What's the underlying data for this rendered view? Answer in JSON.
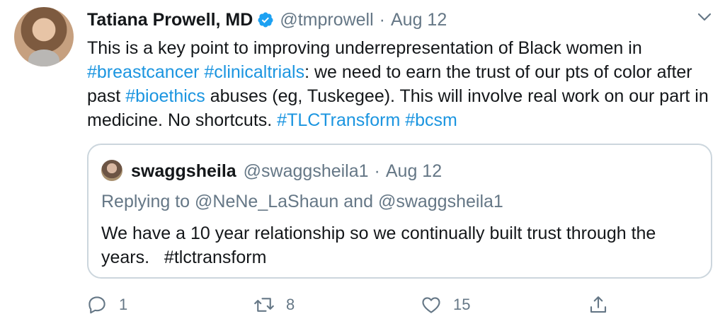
{
  "tweet": {
    "author": {
      "display_name": "Tatiana Prowell, MD",
      "handle": "@tmprowell",
      "verified": true
    },
    "separator": "·",
    "date": "Aug 12",
    "text_parts": {
      "p1": "This is a key point to improving underrepresentation of Black women in ",
      "tag1": "#breastcancer",
      "sp1": " ",
      "tag2": "#clinicaltrials",
      "p2": ": we need to earn the trust of our pts of color after past ",
      "tag3": "#bioethics",
      "p3": " abuses (eg, Tuskegee). This will involve real work on our part in medicine. No shortcuts. ",
      "tag4": "#TLCTransform",
      "sp2": " ",
      "tag5": "#bcsm"
    },
    "accent_color": "#1b95e0",
    "icons": {
      "more": "chevron-down-icon",
      "verified": "verified-badge-icon"
    }
  },
  "quoted": {
    "display_name": "swaggsheila",
    "handle": "@swaggsheila1",
    "separator": "·",
    "date": "Aug 12",
    "replying_prefix": "Replying to ",
    "replying_to_1": "@NeNe_LaShaun",
    "replying_and": " and ",
    "replying_to_2": "@swaggsheila1",
    "text": "We have a 10 year relationship so we continually built trust through the years.   #tlctransform"
  },
  "actions": {
    "reply_count": "1",
    "retweet_count": "8",
    "like_count": "15",
    "icons": [
      "reply-icon",
      "retweet-icon",
      "like-icon",
      "share-icon"
    ]
  }
}
